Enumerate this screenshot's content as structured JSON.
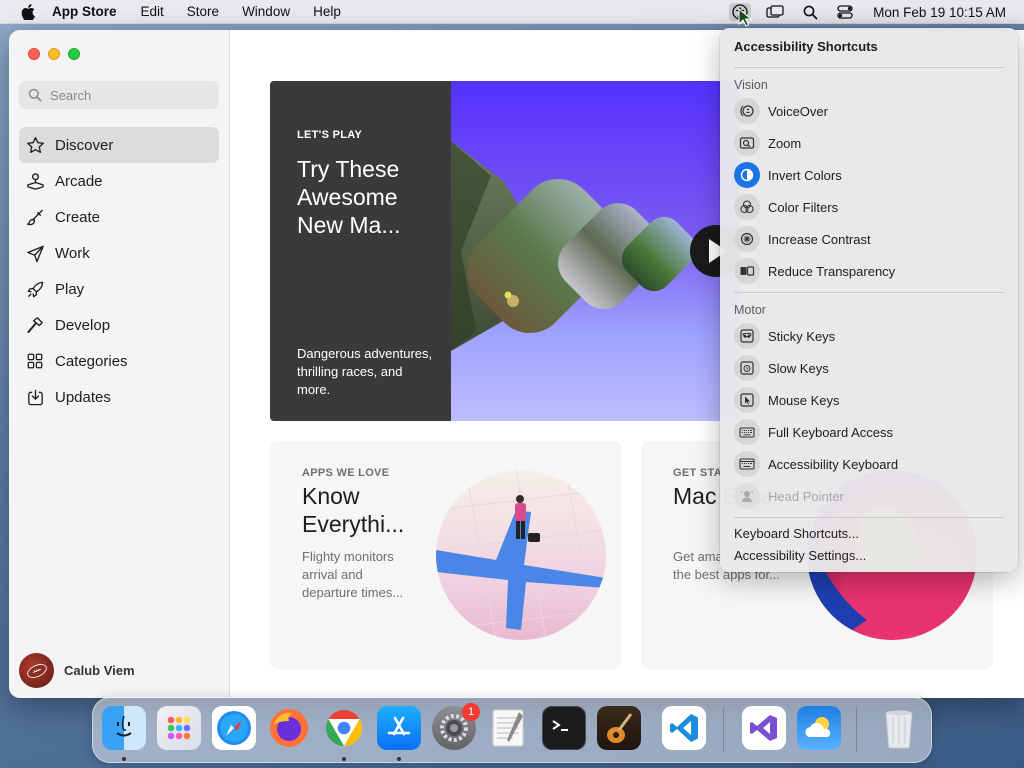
{
  "menubar": {
    "app_name": "App Store",
    "menus": [
      "Edit",
      "Store",
      "Window",
      "Help"
    ],
    "clock": "Mon Feb 19  10:15 AM"
  },
  "sidebar": {
    "search_placeholder": "Search",
    "items": [
      {
        "label": "Discover",
        "icon": "star-icon",
        "selected": true
      },
      {
        "label": "Arcade",
        "icon": "joystick-icon"
      },
      {
        "label": "Create",
        "icon": "paintbrush-icon"
      },
      {
        "label": "Work",
        "icon": "paperplane-icon"
      },
      {
        "label": "Play",
        "icon": "rocket-icon"
      },
      {
        "label": "Develop",
        "icon": "hammer-icon"
      },
      {
        "label": "Categories",
        "icon": "grid-icon"
      },
      {
        "label": "Updates",
        "icon": "download-icon"
      }
    ],
    "user_name": "Calub Viem"
  },
  "hero": {
    "eyebrow": "LET'S PLAY",
    "title": "Try These Awesome New Ma...",
    "description": "Dangerous adventures, thrilling races, and more."
  },
  "cards": [
    {
      "eyebrow": "APPS WE LOVE",
      "title": "Know Everythi...",
      "description": "Flighty monitors arrival and departure times..."
    },
    {
      "eyebrow": "GET STA",
      "title": "Mac Esse",
      "description": "Get ama games and the best apps for..."
    }
  ],
  "accessibility_menu": {
    "title": "Accessibility Shortcuts",
    "vision_label": "Vision",
    "vision_items": [
      {
        "label": "VoiceOver",
        "icon": "voiceover-icon"
      },
      {
        "label": "Zoom",
        "icon": "zoom-icon"
      },
      {
        "label": "Invert Colors",
        "icon": "invert-colors-icon",
        "on": true
      },
      {
        "label": "Color Filters",
        "icon": "color-filters-icon"
      },
      {
        "label": "Increase Contrast",
        "icon": "increase-contrast-icon"
      },
      {
        "label": "Reduce Transparency",
        "icon": "reduce-transparency-icon"
      }
    ],
    "motor_label": "Motor",
    "motor_items": [
      {
        "label": "Sticky Keys",
        "icon": "sticky-keys-icon"
      },
      {
        "label": "Slow Keys",
        "icon": "slow-keys-icon"
      },
      {
        "label": "Mouse Keys",
        "icon": "mouse-keys-icon"
      },
      {
        "label": "Full Keyboard Access",
        "icon": "keyboard-icon"
      },
      {
        "label": "Accessibility Keyboard",
        "icon": "accessibility-keyboard-icon"
      },
      {
        "label": "Head Pointer",
        "icon": "head-pointer-icon",
        "disabled": true
      }
    ],
    "keyboard_shortcuts": "Keyboard Shortcuts...",
    "settings": "Accessibility Settings..."
  },
  "dock": {
    "apps": [
      "Finder",
      "Launchpad",
      "Safari",
      "Firefox",
      "Chrome",
      "App Store",
      "System Settings",
      "TextEdit",
      "Terminal",
      "GarageBand",
      "VS Code",
      "Visual Studio",
      "Weather",
      "Trash"
    ],
    "system_settings_badge": "1"
  },
  "colors": {
    "accent": "#1a73e8",
    "hero_dark": "#3a3a3c",
    "hero_purple": "#5532ff"
  }
}
